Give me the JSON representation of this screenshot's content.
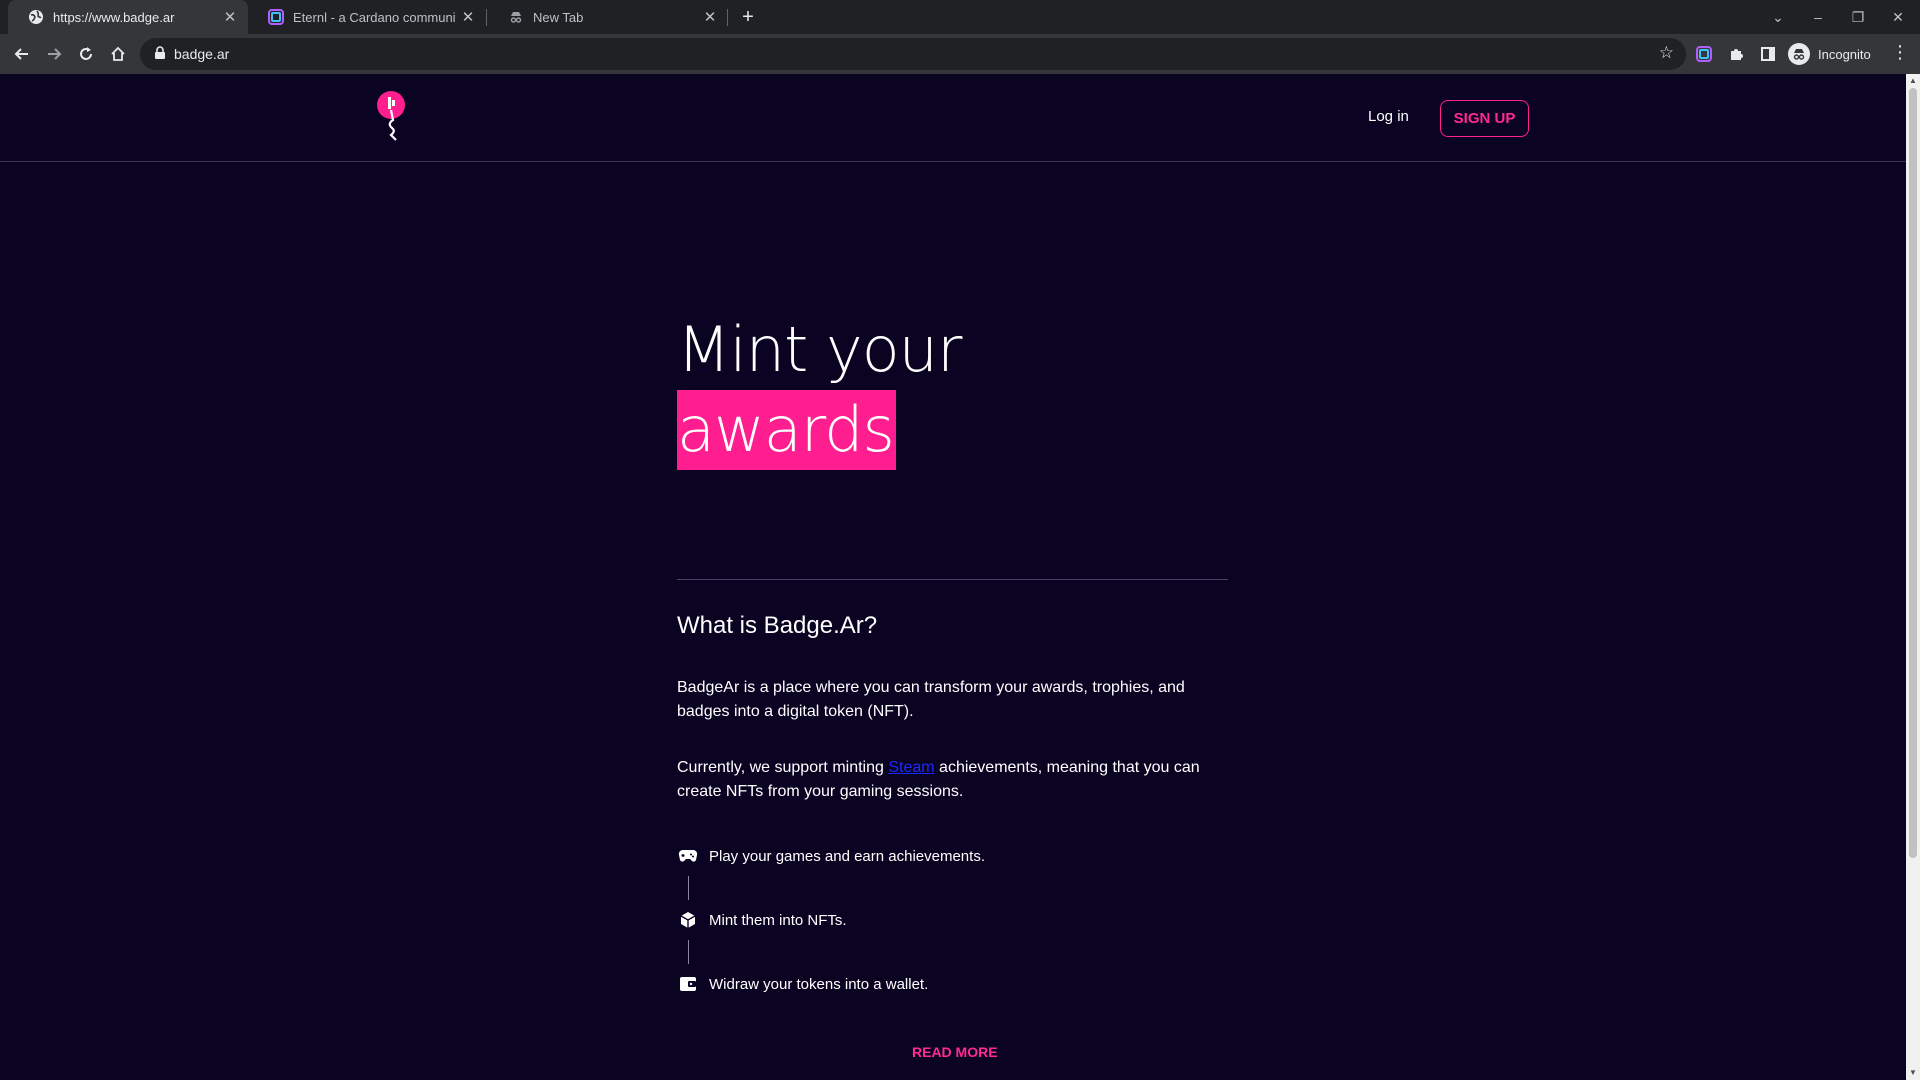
{
  "browser": {
    "tabs": [
      {
        "title": "https://www.badge.ar",
        "icon": "globe-icon",
        "active": true
      },
      {
        "title": "Eternl - a Cardano community w",
        "icon": "eternl-icon",
        "active": false
      },
      {
        "title": "New Tab",
        "icon": "incognito-icon",
        "active": false
      }
    ],
    "url": "badge.ar",
    "profile_label": "Incognito"
  },
  "site": {
    "nav": {
      "login_label": "Log in",
      "signup_label": "SIGN UP"
    },
    "hero": {
      "line1": "Mint your",
      "line2": "awards"
    },
    "about": {
      "title": "What is Badge.Ar?",
      "para1": "BadgeAr is a place where you can transform your awards, trophies, and badges into a digital token (NFT).",
      "para2_before": "Currently, we support minting ",
      "para2_link": "Steam",
      "para2_after": " achievements, meaning that you can create NFTs from your gaming sessions."
    },
    "steps": [
      {
        "icon": "gamepad-icon",
        "text": "Play your games and earn achievements."
      },
      {
        "icon": "cube-icon",
        "text": "Mint them into NFTs."
      },
      {
        "icon": "wallet-icon",
        "text": "Widraw your tokens into a wallet."
      }
    ],
    "read_more_label": "READ MORE"
  },
  "colors": {
    "page_bg": "#0a0322",
    "accent": "#ff1e8f",
    "link": "#1a2aff"
  }
}
